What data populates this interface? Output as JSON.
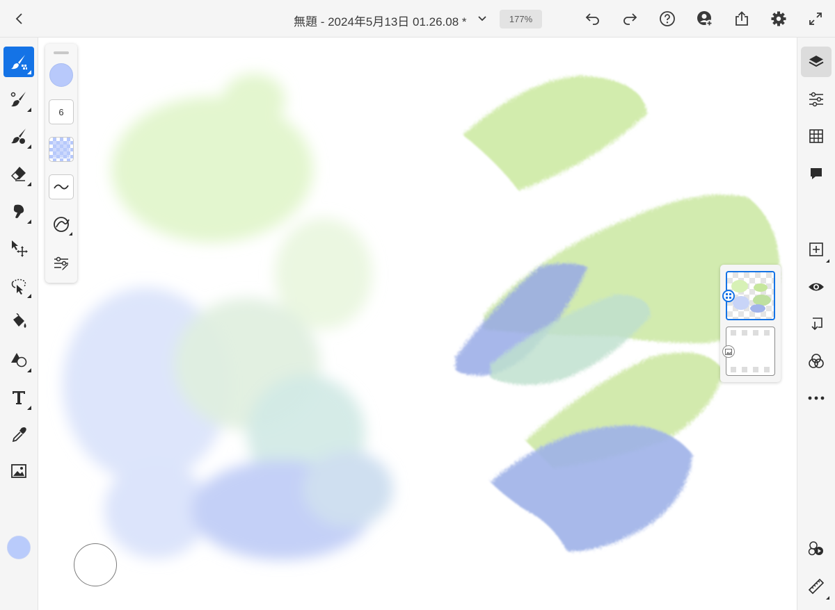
{
  "app": {
    "document_title": "無題 - 2024年5月13日 01.26.08 *",
    "zoom_level": "177%"
  },
  "topbar": {
    "icons": [
      "back-icon",
      "chevron-down-icon",
      "undo-icon",
      "redo-icon",
      "help-icon",
      "invite-user-icon",
      "share-icon",
      "settings-icon",
      "fullscreen-icon"
    ]
  },
  "left_toolbar": {
    "tools": [
      {
        "name": "pixel-brush-tool",
        "icon": "pixel-brush-icon",
        "active": true
      },
      {
        "name": "live-brush-tool",
        "icon": "paint-brush-icon",
        "active": false
      },
      {
        "name": "vector-brush-tool",
        "icon": "vector-brush-icon",
        "active": false
      },
      {
        "name": "eraser-tool",
        "icon": "eraser-icon",
        "active": false
      },
      {
        "name": "smudge-tool",
        "icon": "smudge-icon",
        "active": false
      },
      {
        "name": "transform-tool",
        "icon": "move-icon",
        "active": false
      },
      {
        "name": "lasso-selection-tool",
        "icon": "lasso-icon",
        "active": false
      },
      {
        "name": "fill-tool",
        "icon": "paint-bucket-icon",
        "active": false
      },
      {
        "name": "shape-tool",
        "icon": "shapes-icon",
        "active": false
      },
      {
        "name": "text-tool",
        "icon": "text-icon",
        "active": false
      },
      {
        "name": "eyedropper-tool",
        "icon": "eyedropper-icon",
        "active": false
      },
      {
        "name": "place-image-tool",
        "icon": "image-icon",
        "active": false
      }
    ],
    "current_color": "#b9cbfb"
  },
  "brush_panel": {
    "brush_size": "6",
    "brush_color": "#b8c9fb",
    "icons": [
      "brush-color-icon",
      "opacity-swatch-icon",
      "smoothing-icon",
      "pressure-dynamics-icon",
      "brush-settings-icon"
    ]
  },
  "right_toolbar": {
    "tools": [
      {
        "name": "layers-button",
        "icon": "layers-icon",
        "active": true
      },
      {
        "name": "layer-properties-button",
        "icon": "sliders-icon",
        "active": false
      },
      {
        "name": "grid-button",
        "icon": "grid-icon",
        "active": false
      },
      {
        "name": "comments-button",
        "icon": "comment-icon",
        "active": false
      },
      {
        "name": "add-layer-button",
        "icon": "add-layer-icon",
        "active": false
      },
      {
        "name": "visibility-button",
        "icon": "eye-icon",
        "active": false
      },
      {
        "name": "merge-down-button",
        "icon": "merge-down-icon",
        "active": false
      },
      {
        "name": "blend-mode-button",
        "icon": "blend-icon",
        "active": false
      },
      {
        "name": "more-button",
        "icon": "more-icon",
        "active": false
      },
      {
        "name": "remix-button",
        "icon": "remix-icon",
        "active": false
      },
      {
        "name": "ruler-button",
        "icon": "ruler-icon",
        "active": false
      }
    ]
  },
  "layers_panel": {
    "layers": [
      {
        "name": "painting-layer",
        "selected": true,
        "badge_icon": "pixel-layer-icon"
      },
      {
        "name": "background-layer",
        "selected": false,
        "badge_icon": "image-layer-icon"
      }
    ]
  },
  "canvas": {
    "colors": {
      "green": "#d7f1b6",
      "blue": "#b8c8f3",
      "accent": "#1473e6"
    }
  }
}
